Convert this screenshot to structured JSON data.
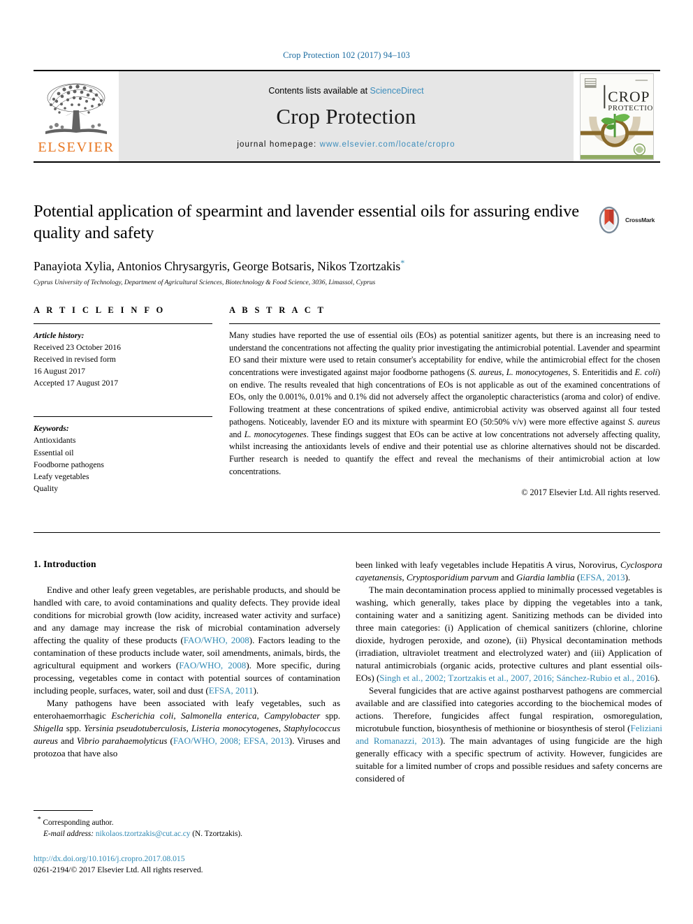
{
  "running_head": "Crop Protection 102 (2017) 94–103",
  "masthead": {
    "publisher_logo_label": "ELSEVIER",
    "contents_prefix": "Contents lists available at ",
    "contents_link": "ScienceDirect",
    "journal_name": "Crop Protection",
    "homepage_prefix": "journal homepage: ",
    "homepage_url": "www.elsevier.com/locate/cropro",
    "cover_title_line1": "CROP",
    "cover_title_line2": "PROTECTION"
  },
  "article": {
    "title": "Potential application of spearmint and lavender essential oils for assuring endive quality and safety",
    "authors": "Panayiota Xylia, Antonios Chrysargyris, George Botsaris, Nikos Tzortzakis",
    "corresponding_marker": "*",
    "affiliation": "Cyprus University of Technology, Department of Agricultural Sciences, Biotechnology & Food Science, 3036, Limassol, Cyprus",
    "crossmark_label": "CrossMark"
  },
  "article_info": {
    "heading": "A R T I C L E  I N F O",
    "history_label": "Article history:",
    "history": [
      "Received 23 October 2016",
      "Received in revised form",
      "16 August 2017",
      "Accepted 17 August 2017"
    ],
    "keywords_label": "Keywords:",
    "keywords": [
      "Antioxidants",
      "Essential oil",
      "Foodborne pathogens",
      "Leafy vegetables",
      "Quality"
    ]
  },
  "abstract": {
    "heading": "A B S T R A C T",
    "paragraph_1": "Many studies have reported the use of essential oils (EOs) as potential sanitizer agents, but there is an increasing need to understand the concentrations not affecting the quality prior investigating the antimicrobial potential. Lavender and spearmint EO sand their mixture were used to retain consumer's acceptability for endive, while the antimicrobial effect for the chosen concentrations were investigated against major foodborne pathogens (",
    "pathogen_1": "S. aureus",
    "pathogen_sep_1": ", ",
    "pathogen_2": "L. monocytogenes",
    "pathogen_sep_2": ", S. Enteritidis and ",
    "pathogen_3": "E. coli",
    "paragraph_2": ") on endive. The results revealed that high concentrations of EOs is not applicable as out of the examined concentrations of EOs, only the 0.001%, 0.01% and 0.1% did not adversely affect the organoleptic characteristics (aroma and color) of endive. Following treatment at these concentrations of spiked endive, antimicrobial activity was observed against all four tested pathogens. Noticeably, lavender EO and its mixture with spearmint EO (50:50% v/v) were more effective against ",
    "pathogen_4": "S. aureus",
    "paragraph_3": " and ",
    "pathogen_5": "L. monocytogenes",
    "paragraph_4": ". These findings suggest that EOs can be active at low concentrations not adversely affecting quality, whilst increasing the antioxidants levels of endive and their potential use as chlorine alternatives should not be discarded. Further research is needed to quantify the effect and reveal the mechanisms of their antimicrobial action at low concentrations.",
    "copyright": "© 2017 Elsevier Ltd. All rights reserved."
  },
  "body": {
    "section_heading": "1. Introduction",
    "left_column": {
      "p1_a": "Endive and other leafy green vegetables, are perishable products, and should be handled with care, to avoid contaminations and quality defects. They provide ideal conditions for microbial growth (low acidity, increased water activity and surface) and any damage may increase the risk of microbial contamination adversely affecting the quality of these products (",
      "p1_ref1": "FAO/WHO, 2008",
      "p1_b": "). Factors leading to the contamination of these products include water, soil amendments, animals, birds, the agricultural equipment and workers (",
      "p1_ref2": "FAO/WHO, 2008",
      "p1_c": "). More specific, during processing, vegetables come in contact with potential sources of contamination including people, surfaces, water, soil and dust (",
      "p1_ref3": "EFSA, 2011",
      "p1_d": ").",
      "p2_a": "Many pathogens have been associated with leafy vegetables, such as enterohaemorrhagic ",
      "p2_sci1": "Escherichia coli",
      "p2_b": ", ",
      "p2_sci2": "Salmonella enterica",
      "p2_c": ", ",
      "p2_sci3": "Campylobacter",
      "p2_d": " spp. ",
      "p2_sci4": "Shigella",
      "p2_e": " spp. ",
      "p2_sci5": "Yersinia pseudotuberculosis",
      "p2_f": ", ",
      "p2_sci6": "Listeria monocytogenes",
      "p2_g": ", ",
      "p2_sci7": "Staphylococcus aureus",
      "p2_h": " and ",
      "p2_sci8": "Vibrio parahaemolyticus",
      "p2_i": " (",
      "p2_ref1": "FAO/WHO, 2008; EFSA, 2013",
      "p2_j": "). Viruses and protozoa that have also"
    },
    "right_column": {
      "p1_a": "been linked with leafy vegetables include Hepatitis A virus, Norovirus, ",
      "p1_sci1": "Cyclospora cayetanensis",
      "p1_b": ", ",
      "p1_sci2": "Cryptosporidium parvum",
      "p1_c": " and ",
      "p1_sci3": "Giardia lamblia",
      "p1_d": " (",
      "p1_ref1": "EFSA, 2013",
      "p1_e": ").",
      "p2_a": "The main decontamination process applied to minimally processed vegetables is washing, which generally, takes place by dipping the vegetables into a tank, containing water and a sanitizing agent. Sanitizing methods can be divided into three main categories: (i) Application of chemical sanitizers (chlorine, chlorine dioxide, hydrogen peroxide, and ozone), (ii) Physical decontamination methods (irradiation, ultraviolet treatment and electrolyzed water) and (iii) Application of natural antimicrobials (organic acids, protective cultures and plant essential oils-EOs) (",
      "p2_ref1": "Singh et al., 2002; Tzortzakis et al., 2007, 2016; Sánchez-Rubio et al., 2016",
      "p2_b": ").",
      "p3_a": "Several fungicides that are active against postharvest pathogens are commercial available and are classified into categories according to the biochemical modes of actions. Therefore, fungicides affect fungal respiration, osmoregulation, microtubule function, biosynthesis of methionine or biosynthesis of sterol (",
      "p3_ref1": "Feliziani and Romanazzi, 2013",
      "p3_b": "). The main advantages of using fungicide are the high generally efficacy with a specific spectrum of activity. However, fungicides are suitable for a limited number of crops and possible residues and safety concerns are considered of"
    }
  },
  "footnote": {
    "corresponding": "Corresponding author.",
    "email_label": "E-mail address:",
    "email": "nikolaos.tzortzakis@cut.ac.cy",
    "email_owner": "(N. Tzortzakis).",
    "doi_url": "http://dx.doi.org/10.1016/j.cropro.2017.08.015",
    "issn_line": "0261-2194/© 2017 Elsevier Ltd. All rights reserved."
  },
  "colors": {
    "link": "#2f89b3",
    "elsevier_orange": "#E87722",
    "masthead_bg": "#e6e6e6"
  }
}
